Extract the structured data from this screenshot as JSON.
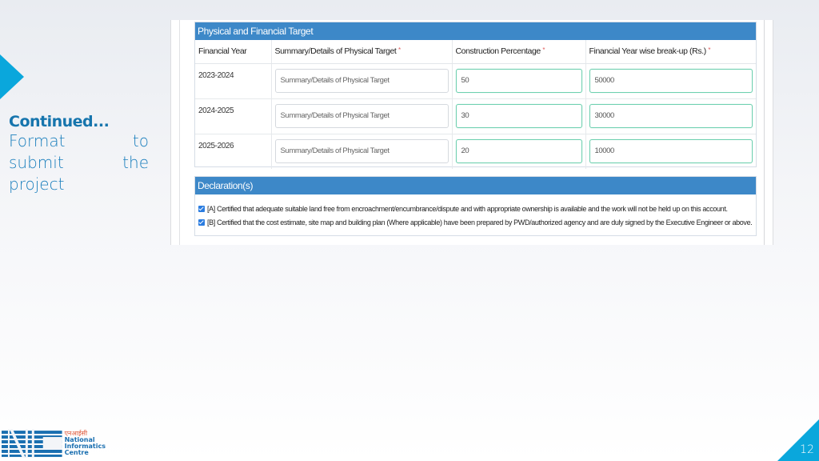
{
  "slide": {
    "heading": "Continued...",
    "body_lines": [
      [
        "Format",
        "to"
      ],
      [
        "submit",
        "the"
      ],
      [
        "project",
        ""
      ]
    ],
    "page_number": "12",
    "accent_color": "#0aa7dc"
  },
  "target_panel": {
    "title": "Physical and Financial Target",
    "columns": [
      {
        "label": "Financial Year",
        "required": false
      },
      {
        "label": "Summary/Details of Physical Target",
        "required": true
      },
      {
        "label": "Construction Percentage",
        "required": true
      },
      {
        "label": "Financial Year wise break-up (Rs.)",
        "required": true
      }
    ],
    "rows": [
      {
        "financial_year": "2023-2024",
        "summary_value": "",
        "summary_placeholder": "Summary/Details of Physical Target",
        "construction_percentage": "50",
        "breakup": "50000"
      },
      {
        "financial_year": "2024-2025",
        "summary_value": "",
        "summary_placeholder": "Summary/Details of Physical Target",
        "construction_percentage": "30",
        "breakup": "30000"
      },
      {
        "financial_year": "2025-2026",
        "summary_value": "",
        "summary_placeholder": "Summary/Details of Physical Target",
        "construction_percentage": "20",
        "breakup": "10000"
      }
    ],
    "header_color": "#3d88c8"
  },
  "declaration_panel": {
    "title": "Declaration(s)",
    "items": [
      {
        "checked": true,
        "text": "[A] Certified that adequate suitable land free from encroachment/encumbrance/dispute and with appropriate ownership is available and the work will not be held up on this account."
      },
      {
        "checked": true,
        "text": "[B] Certified that the cost estimate, site map and building plan (Where applicable) have been prepared by PWD/authorized agency and are duly signed by the Executive Engineer or above."
      }
    ]
  },
  "logo": {
    "mark": "NIC",
    "hindi": "एनआईसी",
    "lines": [
      "National",
      "Informatics",
      "Centre"
    ]
  }
}
